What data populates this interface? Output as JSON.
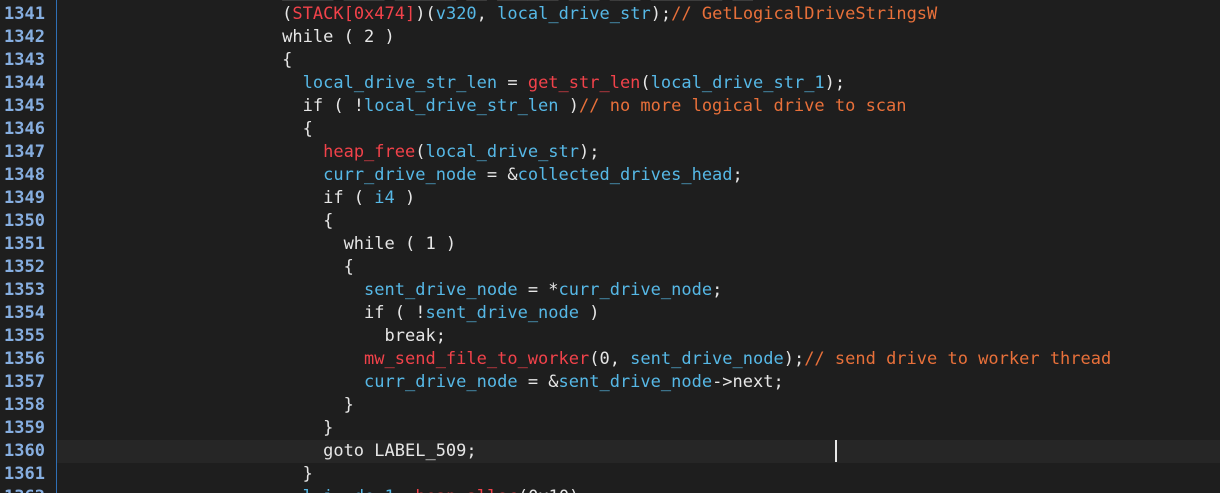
{
  "colors": {
    "background": "#1e1e1e",
    "line_number": "#86aee0",
    "keyword": "#e6e6e6",
    "identifier": "#56b8e6",
    "function": "#f1424a",
    "comment": "#e8703a",
    "current_line": "#262626"
  },
  "partial_top_tokens": [
    {
      "t": "                      ",
      "c": "pl"
    },
    {
      "t": "_____ ____ ______ __ ______ ___ ___ _______ __",
      "c": "pl"
    }
  ],
  "partial_bottom_tokens": [
    {
      "t": "                      ",
      "c": "pl"
    },
    {
      "t": "  ",
      "c": "pl"
    },
    {
      "t": "l",
      "c": "id"
    },
    {
      "t": "_",
      "c": "pl"
    },
    {
      "t": "i",
      "c": "id"
    },
    {
      "t": "  ",
      "c": "pl"
    },
    {
      "t": "d",
      "c": "id"
    },
    {
      "t": "e",
      "c": "id"
    },
    {
      "t": "_",
      "c": "pl"
    },
    {
      "t": "1",
      "c": "id"
    },
    {
      "t": "  ",
      "c": "pl"
    },
    {
      "t": "h",
      "c": "fn"
    },
    {
      "t": "e",
      "c": "fn"
    },
    {
      "t": "a",
      "c": "fn"
    },
    {
      "t": "p",
      "c": "fn"
    },
    {
      "t": "_",
      "c": "pl"
    },
    {
      "t": "a",
      "c": "fn"
    },
    {
      "t": "l",
      "c": "fn"
    },
    {
      "t": "l",
      "c": "fn"
    },
    {
      "t": "o",
      "c": "fn"
    },
    {
      "t": "c",
      "c": "fn"
    },
    {
      "t": "(0x10)",
      "c": "pl"
    }
  ],
  "lines": [
    {
      "num": "1341",
      "tokens": [
        {
          "t": "                      (",
          "c": "pl"
        },
        {
          "t": "STACK[0x474]",
          "c": "fn"
        },
        {
          "t": ")(",
          "c": "pl"
        },
        {
          "t": "v320",
          "c": "id"
        },
        {
          "t": ", ",
          "c": "pl"
        },
        {
          "t": "local_drive_str",
          "c": "id"
        },
        {
          "t": ");",
          "c": "pl"
        },
        {
          "t": "// GetLogicalDriveStringsW",
          "c": "cm"
        }
      ]
    },
    {
      "num": "1342",
      "tokens": [
        {
          "t": "                      while ( 2 )",
          "c": "kw"
        }
      ]
    },
    {
      "num": "1343",
      "tokens": [
        {
          "t": "                      {",
          "c": "pl"
        }
      ]
    },
    {
      "num": "1344",
      "tokens": [
        {
          "t": "                        ",
          "c": "pl"
        },
        {
          "t": "local_drive_str_len",
          "c": "id"
        },
        {
          "t": " = ",
          "c": "pl"
        },
        {
          "t": "get_str_len",
          "c": "fn"
        },
        {
          "t": "(",
          "c": "pl"
        },
        {
          "t": "local_drive_str_1",
          "c": "id"
        },
        {
          "t": ");",
          "c": "pl"
        }
      ]
    },
    {
      "num": "1345",
      "tokens": [
        {
          "t": "                        if ( !",
          "c": "kw"
        },
        {
          "t": "local_drive_str_len",
          "c": "id"
        },
        {
          "t": " )",
          "c": "pl"
        },
        {
          "t": "// no more logical drive to scan",
          "c": "cm"
        }
      ]
    },
    {
      "num": "1346",
      "tokens": [
        {
          "t": "                        {",
          "c": "pl"
        }
      ]
    },
    {
      "num": "1347",
      "tokens": [
        {
          "t": "                          ",
          "c": "pl"
        },
        {
          "t": "heap_free",
          "c": "fn"
        },
        {
          "t": "(",
          "c": "pl"
        },
        {
          "t": "local_drive_str",
          "c": "id"
        },
        {
          "t": ");",
          "c": "pl"
        }
      ]
    },
    {
      "num": "1348",
      "tokens": [
        {
          "t": "                          ",
          "c": "pl"
        },
        {
          "t": "curr_drive_node",
          "c": "id"
        },
        {
          "t": " = &",
          "c": "pl"
        },
        {
          "t": "collected_drives_head",
          "c": "id"
        },
        {
          "t": ";",
          "c": "pl"
        }
      ]
    },
    {
      "num": "1349",
      "tokens": [
        {
          "t": "                          if ( ",
          "c": "kw"
        },
        {
          "t": "i4",
          "c": "id"
        },
        {
          "t": " )",
          "c": "pl"
        }
      ]
    },
    {
      "num": "1350",
      "tokens": [
        {
          "t": "                          {",
          "c": "pl"
        }
      ]
    },
    {
      "num": "1351",
      "tokens": [
        {
          "t": "                            while ( 1 )",
          "c": "kw"
        }
      ]
    },
    {
      "num": "1352",
      "tokens": [
        {
          "t": "                            {",
          "c": "pl"
        }
      ]
    },
    {
      "num": "1353",
      "tokens": [
        {
          "t": "                              ",
          "c": "pl"
        },
        {
          "t": "sent_drive_node",
          "c": "id"
        },
        {
          "t": " = *",
          "c": "pl"
        },
        {
          "t": "curr_drive_node",
          "c": "id"
        },
        {
          "t": ";",
          "c": "pl"
        }
      ]
    },
    {
      "num": "1354",
      "tokens": [
        {
          "t": "                              if ( !",
          "c": "kw"
        },
        {
          "t": "sent_drive_node",
          "c": "id"
        },
        {
          "t": " )",
          "c": "pl"
        }
      ]
    },
    {
      "num": "1355",
      "tokens": [
        {
          "t": "                                break;",
          "c": "kw"
        }
      ]
    },
    {
      "num": "1356",
      "tokens": [
        {
          "t": "                              ",
          "c": "pl"
        },
        {
          "t": "mw_send_file_to_worker",
          "c": "fn"
        },
        {
          "t": "(0, ",
          "c": "pl"
        },
        {
          "t": "sent_drive_node",
          "c": "id"
        },
        {
          "t": ");",
          "c": "pl"
        },
        {
          "t": "// send drive to worker thread",
          "c": "cm"
        }
      ]
    },
    {
      "num": "1357",
      "tokens": [
        {
          "t": "                              ",
          "c": "pl"
        },
        {
          "t": "curr_drive_node",
          "c": "id"
        },
        {
          "t": " = &",
          "c": "pl"
        },
        {
          "t": "sent_drive_node",
          "c": "id"
        },
        {
          "t": "->next;",
          "c": "pl"
        }
      ]
    },
    {
      "num": "1358",
      "tokens": [
        {
          "t": "                            }",
          "c": "pl"
        }
      ]
    },
    {
      "num": "1359",
      "tokens": [
        {
          "t": "                          }",
          "c": "pl"
        }
      ]
    },
    {
      "num": "1360",
      "current": true,
      "tokens": [
        {
          "t": "                          goto LABEL_509;",
          "c": "kw"
        }
      ]
    },
    {
      "num": "1361",
      "tokens": [
        {
          "t": "                        }",
          "c": "pl"
        }
      ]
    }
  ],
  "partial_bottom_num": "1362"
}
